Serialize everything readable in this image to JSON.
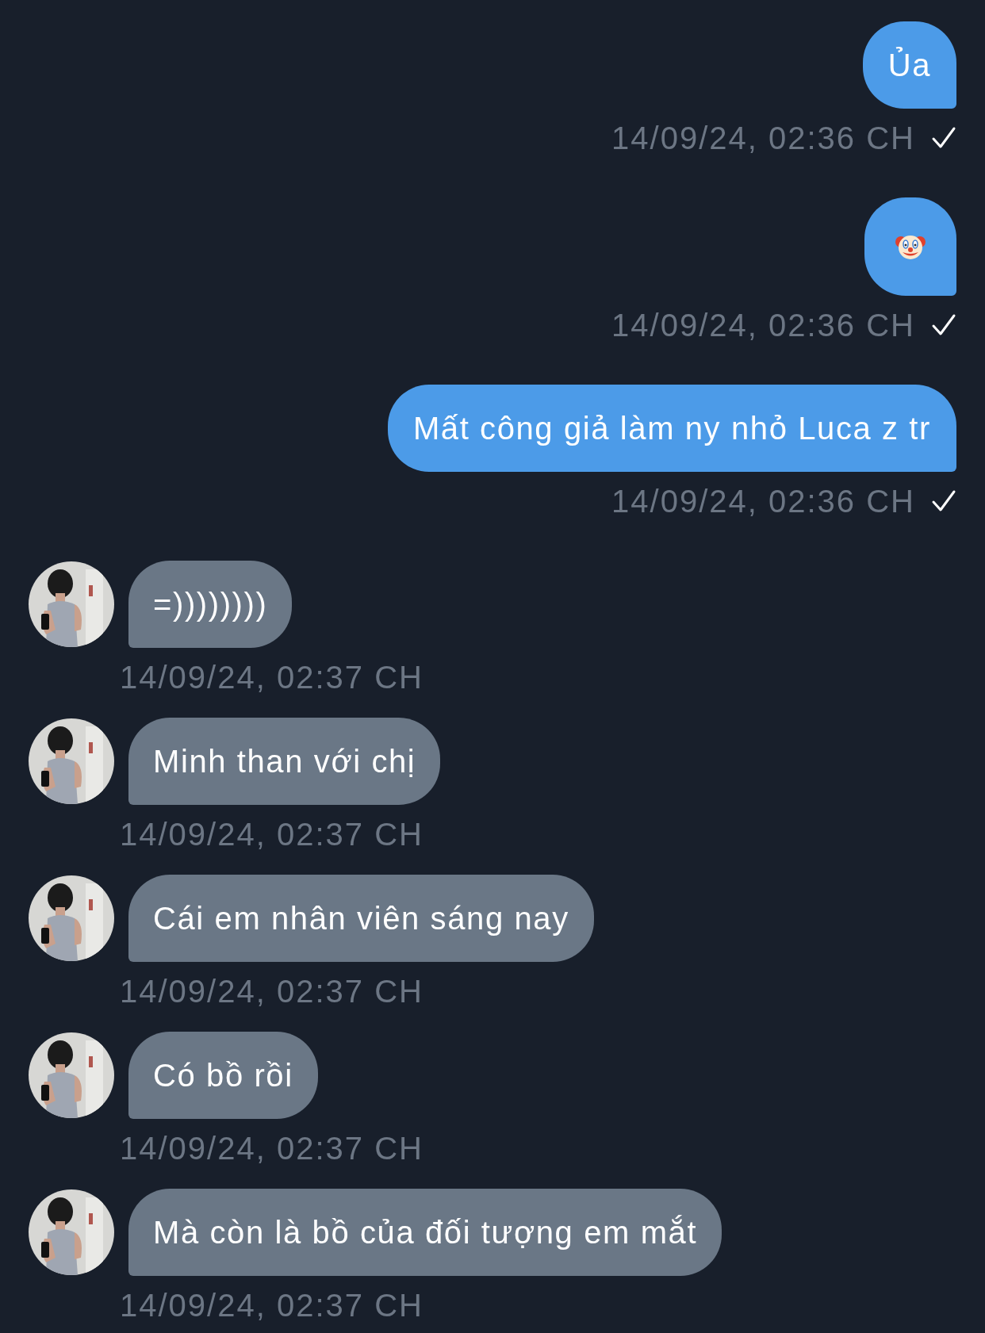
{
  "messages": [
    {
      "outgoing": true,
      "kind": "text",
      "text": "Ủa",
      "time": "14/09/24, 02:36 CH",
      "delivered": true
    },
    {
      "outgoing": true,
      "kind": "emoji",
      "time": "14/09/24, 02:36 CH",
      "delivered": true
    },
    {
      "outgoing": true,
      "kind": "text",
      "text": "Mất công giả làm ny nhỏ Luca z tr",
      "time": "14/09/24, 02:36 CH",
      "delivered": true
    },
    {
      "outgoing": false,
      "kind": "text",
      "text": "=))))))))",
      "time": "14/09/24, 02:37 CH"
    },
    {
      "outgoing": false,
      "kind": "text",
      "text": "Minh than với chị",
      "time": "14/09/24, 02:37 CH"
    },
    {
      "outgoing": false,
      "kind": "text",
      "text": "Cái em nhân viên sáng nay",
      "time": "14/09/24, 02:37 CH"
    },
    {
      "outgoing": false,
      "kind": "text",
      "text": "Có bồ rồi",
      "time": "14/09/24, 02:37 CH"
    },
    {
      "outgoing": false,
      "kind": "text",
      "text": "Mà còn là bồ của đối tượng em mắt",
      "time": "14/09/24, 02:37 CH"
    }
  ]
}
